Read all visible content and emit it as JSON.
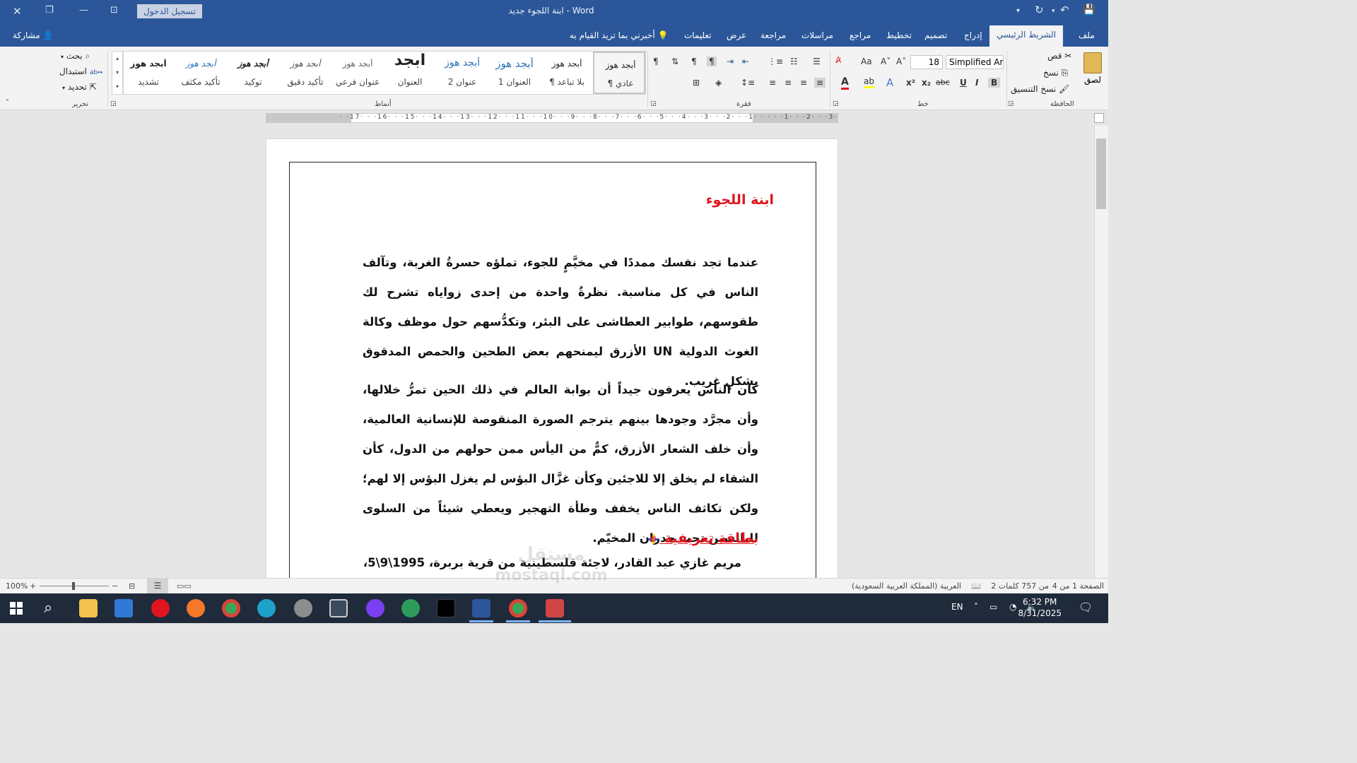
{
  "titlebar": {
    "signin_label": "تسجيل الدخول",
    "doc_title": "ابنة اللجوء جديد",
    "app_name": "Word",
    "separator": "-"
  },
  "tabs": [
    "ملف",
    "الشريط الرئيسي",
    "إدراج",
    "تصميم",
    "تخطيط",
    "مراجع",
    "مراسلات",
    "مراجعة",
    "عرض",
    "تعليمات"
  ],
  "tell_me": "أخبرني بما تريد القيام به",
  "share": "مشاركة",
  "clipboard": {
    "paste": "لصق",
    "cut": "قص",
    "copy": "نسخ",
    "format_painter": "نسخ التنسيق",
    "group_label": "الحافظة"
  },
  "font": {
    "name": "Simplified Arab",
    "size": "18",
    "group_label": "خط"
  },
  "paragraph": {
    "group_label": "فقرة"
  },
  "styles": {
    "group_label": "أنماط",
    "items": [
      {
        "preview": "أبجد هوز",
        "name": "¶ عادي"
      },
      {
        "preview": "أبجد هوز",
        "name": "¶ بلا تباعد"
      },
      {
        "preview": "أبجد هوز",
        "name": "العنوان 1"
      },
      {
        "preview": "أبجد هوز",
        "name": "عنوان 2"
      },
      {
        "preview": "ابجد",
        "name": "العنوان"
      },
      {
        "preview": "أبجد هوز",
        "name": "عنوان فرعي"
      },
      {
        "preview": "أبجد هوز",
        "name": "تأكيد دقيق"
      },
      {
        "preview": "أبجد هوز",
        "name": "توكيد"
      },
      {
        "preview": "أبجد هوز",
        "name": "تأكيد مكثف"
      },
      {
        "preview": "أبجد هوز",
        "name": "تشديد"
      }
    ]
  },
  "editing": {
    "find": "بحث",
    "replace": "استبدال",
    "select": "تحديد",
    "group_label": "تحرير"
  },
  "ruler": {
    "numbers": "·3· · ·2· · ·1· · · · ·1· · ·2· · ·3· · ·4· · ·5· · ·6· · ·7· · ·8· · ·9· · ·10· · ·11· · ·12· · ·13· · ·14· · ·15· · ·16· · ·17· ·"
  },
  "document": {
    "title": "ابنة اللجوء",
    "para1": "عندما تجد نفسك ممددًا في مخيَّمٍ للجوء، تملؤه حسرةُ الغربة، وتآلف الناس في كل مناسبة. نظرةٌ واحدة من إحدى زواياه تشرح لك طقوسهم، طوابير العطاشى على البئر، وتكدُّسهم حول موظف وكالة الغوث الدولية UN الأزرق ليمنحهم بعض الطحين والحمص المدقوق بشكلٍ غريب.",
    "para2": "كان الناس يعرفون جيداً أن بوابة العالم في ذلك الحين تمرُّ خلالها، وأن مجرَّد وجودها بينهم يترجم الصورة المنقوصة للإنسانية العالمية، وأن خلف الشعار الأزرق، كمٌّ من اليأس ممن حولهم من الدول، كأن الشقاء لم يخلق إلا للاجئين وكأن غزَّال البؤس لم يغزل البؤس إلا لهم؛ ولكن تكاثف الناس يخفف وطأة التهجير ويعطي شيئاً من السلوى للبائسين تحت جدران المخيّم.",
    "card_heading": "بطاقة تعريفية",
    "card_line": "مريم غازي عبد القادر، لاجئة فلسطينية من قرية بربرة، 1995\\9\\5،"
  },
  "statusbar": {
    "page": "الصفحة 1 من 4",
    "words": "2 من 757 كلمات",
    "language": "العربية (المملكة العربية السعودية)",
    "zoom": "100%"
  },
  "taskbar": {
    "lang": "EN",
    "time": "6:32 PM",
    "date": "8/31/2025"
  },
  "watermark": {
    "line1": "مستقل",
    "line2": "mostaql.com"
  },
  "colors": {
    "brand": "#2b579a",
    "title_red": "#e0141e",
    "taskbar": "#1f2a3b"
  }
}
